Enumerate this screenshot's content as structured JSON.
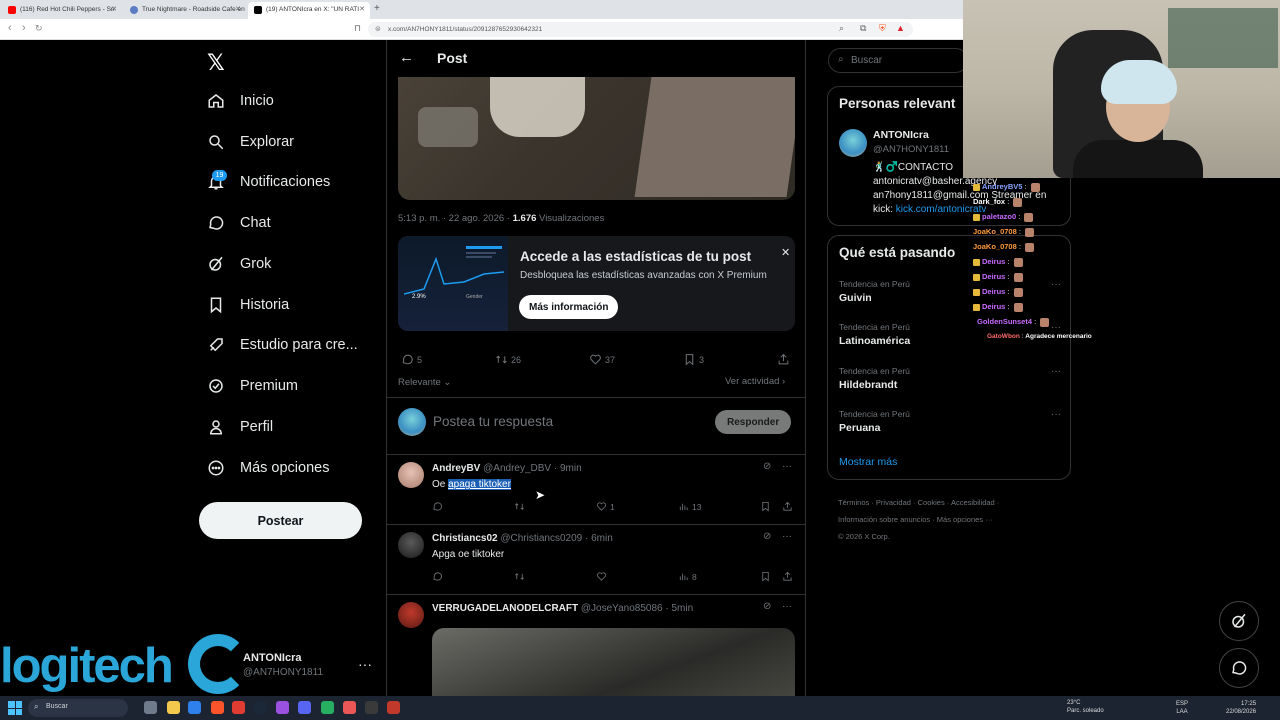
{
  "browser": {
    "tabs": [
      {
        "title": "(116) Red Hot Chili Peppers - Sn",
        "icon_color": "#ff0000"
      },
      {
        "title": "True Nightmare - Roadside Cafe en",
        "icon_color": "#5b7cc4"
      },
      {
        "title": "(19) ANTONIcra en X: \"UN RATI",
        "icon_color": "#000000"
      }
    ],
    "new_tab": "+",
    "url": "x.com/AN7HONY1811/status/2091287652930642321"
  },
  "sidebar": {
    "logo": "𝕏",
    "items": [
      {
        "label": "Inicio",
        "icon": "home-icon"
      },
      {
        "label": "Explorar",
        "icon": "search-icon"
      },
      {
        "label": "Notificaciones",
        "icon": "bell-icon"
      },
      {
        "label": "Chat",
        "icon": "chat-icon"
      },
      {
        "label": "Grok",
        "icon": "grok-icon"
      },
      {
        "label": "Historia",
        "icon": "bookmark-icon"
      },
      {
        "label": "Estudio para cre...",
        "icon": "rocket-icon"
      },
      {
        "label": "Premium",
        "icon": "verified-icon"
      },
      {
        "label": "Perfil",
        "icon": "person-icon"
      },
      {
        "label": "Más opciones",
        "icon": "more-icon"
      }
    ],
    "notif_count": "19",
    "post_button": "Postear",
    "account": {
      "name": "ANTONIcra",
      "handle": "@AN7HONY1811"
    }
  },
  "overlay_logo": "logitech",
  "post": {
    "header_title": "Post",
    "timestamp": "5:13 p. m. · 22 ago. 2026 ·",
    "views": "1.676",
    "views_label": "Visualizaciones",
    "stats_card": {
      "title": "Accede a las estadísticas de tu post",
      "description": "Desbloquea las estadísticas avanzadas con X Premium",
      "button": "Más información",
      "thumb_value": "2.9%",
      "thumb_label": "Gender"
    },
    "actions": {
      "replies": "5",
      "reposts": "26",
      "likes": "37",
      "bookmarks": "3"
    },
    "sort_label": "Relevante",
    "activity_label": "Ver actividad",
    "reply_placeholder": "Postea tu respuesta",
    "reply_button": "Responder"
  },
  "comments": [
    {
      "name": "AndreyBV",
      "handle": "@Andrey_DBV",
      "time": "· 9min",
      "text_prefix": "Oe ",
      "text_highlight": "apaga tiktoker",
      "likes": "1",
      "views": "13"
    },
    {
      "name": "Christiancs02",
      "handle": "@Christiancs0209",
      "time": "· 6min",
      "text_prefix": "Apga oe tiktoker",
      "text_highlight": "",
      "likes": "",
      "views": "8"
    },
    {
      "name": "VERRUGADELANODELCRAFT",
      "handle": "@JoseYano85086",
      "time": "· 5min"
    }
  ],
  "right": {
    "search_placeholder": "Buscar",
    "relevant": {
      "title": "Personas relevant",
      "name": "ANTONIcra",
      "handle": "@AN7HONY1811",
      "bio_line1": "🕺♂️CONTACTO",
      "bio_line2": "antonicratv@basher.agency",
      "bio_line3": "an7hony1811@gmail.com Streamer en",
      "bio_kick_label": "kick:",
      "bio_kick_link": "kick.com/antonicratv"
    },
    "trends": {
      "title": "Qué está pasando",
      "items": [
        {
          "category": "Tendencia en Perú",
          "name": "Guivin"
        },
        {
          "category": "Tendencia en Perú",
          "name": "Latinoamérica"
        },
        {
          "category": "Tendencia en Perú",
          "name": "Hildebrandt"
        },
        {
          "category": "Tendencia en Perú",
          "name": "Peruana"
        }
      ],
      "show_more": "Mostrar más"
    },
    "footer": {
      "links1": "Términos · Privacidad · Cookies · Accesibilidad ·",
      "links2": "Información sobre anuncios · Más opciones ···",
      "copyright": "© 2026 X Corp."
    }
  },
  "stream_chat": [
    {
      "user": "AndreyBV5",
      "color": "#8aa4ff"
    },
    {
      "user": "Dark_fox",
      "color": "#ffffff"
    },
    {
      "user": "paletazo0",
      "color": "#c86bff"
    },
    {
      "user": "JoaKo_0708",
      "color": "#ff9a3c"
    },
    {
      "user": "JoaKo_0708",
      "color": "#ff9a3c"
    },
    {
      "user": "Deirus",
      "color": "#c86bff"
    },
    {
      "user": "Deirus",
      "color": "#c86bff"
    },
    {
      "user": "Deirus",
      "color": "#c86bff"
    },
    {
      "user": "Deirus",
      "color": "#c86bff"
    },
    {
      "user": "GoldenSunset4",
      "color": "#c86bff"
    },
    {
      "user": "GatoWbon",
      "color": "#ff6b6b",
      "message": "Agradece mercenario"
    }
  ],
  "taskbar": {
    "search": "Buscar",
    "weather_temp": "23°C",
    "weather_desc": "Parc. soleado",
    "lang1": "ESP",
    "lang2": "LAA",
    "time": "17:25",
    "date": "22/08/2026"
  }
}
